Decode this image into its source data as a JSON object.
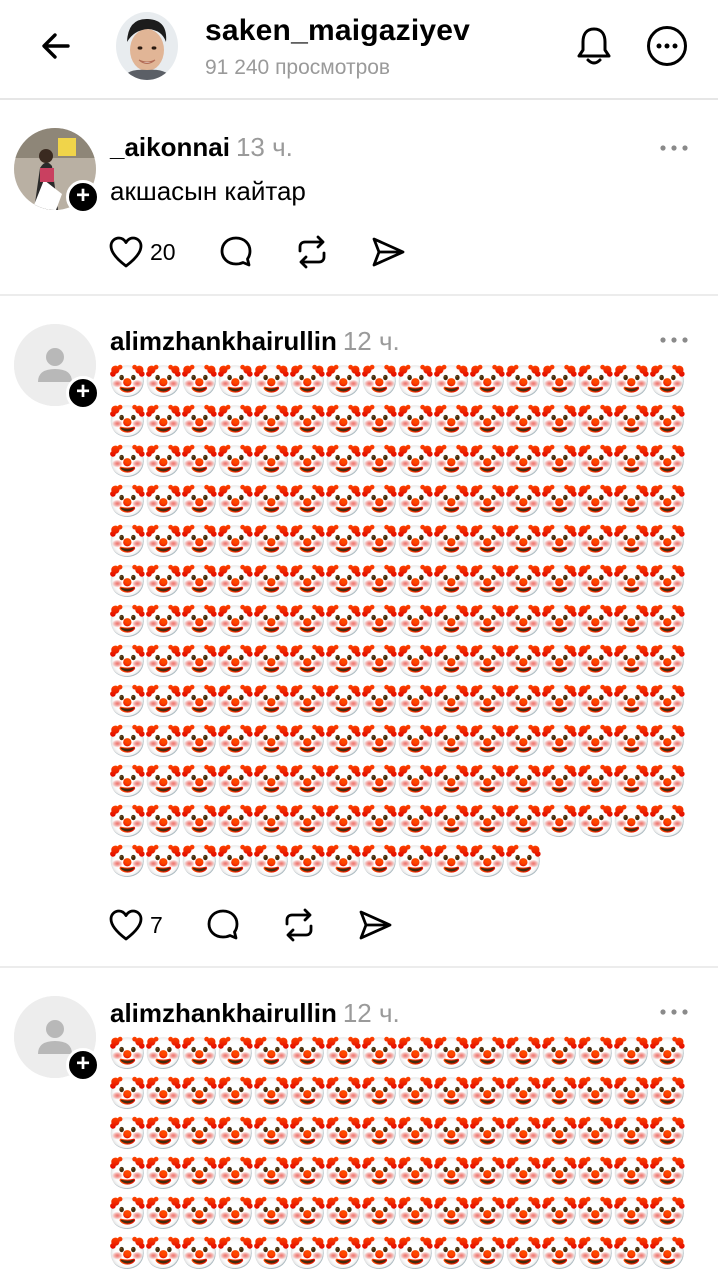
{
  "header": {
    "username": "saken_maigaziyev",
    "views": "91 240 просмотров",
    "icons": {
      "back": "arrow-left-icon",
      "bell": "bell-icon",
      "more": "more-circle-icon"
    }
  },
  "posts": [
    {
      "username": "_aikonnai",
      "time": "13 ч.",
      "text": "акшасын кайтар",
      "likes": "20",
      "avatar": "photo"
    },
    {
      "username": "alimzhankhairullin",
      "time": "12 ч.",
      "text_emoji": "🤡",
      "emoji_count": 204,
      "likes": "7",
      "avatar": "default"
    },
    {
      "username": "alimzhankhairullin",
      "time": "12 ч.",
      "text_emoji": "🤡",
      "emoji_count": 96,
      "avatar": "default"
    }
  ],
  "icons": {
    "like": "heart-icon",
    "comment": "comment-icon",
    "repost": "repost-icon",
    "share": "send-icon",
    "post_more": "ellipsis-icon",
    "follow": "plus-icon"
  },
  "colors": {
    "muted": "#9a9a9a",
    "divider": "#ececec"
  }
}
